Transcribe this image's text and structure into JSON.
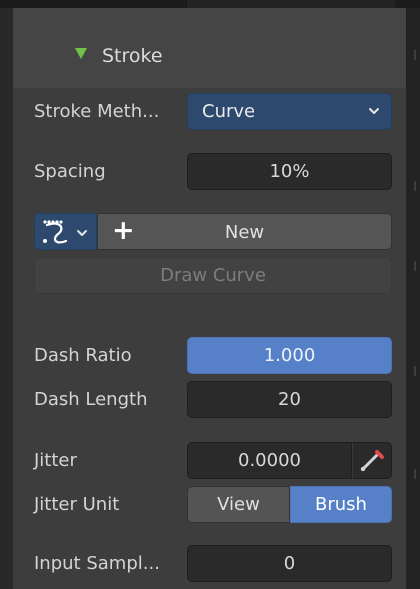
{
  "section": {
    "title": "Stroke",
    "expanded": true
  },
  "stroke_method": {
    "label": "Stroke Meth...",
    "value": "Curve"
  },
  "spacing": {
    "label": "Spacing",
    "value": "10%"
  },
  "curve_tools": {
    "new_label": "New",
    "draw_curve_label": "Draw Curve"
  },
  "dash_ratio": {
    "label": "Dash Ratio",
    "value": "1.000"
  },
  "dash_length": {
    "label": "Dash Length",
    "value": "20"
  },
  "jitter": {
    "label": "Jitter",
    "value": "0.0000"
  },
  "jitter_unit": {
    "label": "Jitter Unit",
    "options": [
      "View",
      "Brush"
    ],
    "selected": "Brush"
  },
  "input_samples": {
    "label": "Input Sampl...",
    "value": "0"
  },
  "colors": {
    "panel_bg": "#3d3d3d",
    "header_bg": "#454545",
    "field_bg": "#2a2a2a",
    "accent_blue": "#5681c9",
    "dropdown_blue": "#2d4a6e",
    "expand_arrow_green": "#71c14a"
  },
  "icons": {
    "expand": "triangle-down-icon",
    "dropdown": "chevron-down-icon",
    "curve": "bezier-curve-icon",
    "add": "plus-icon",
    "pressure": "pen-pressure-icon"
  }
}
